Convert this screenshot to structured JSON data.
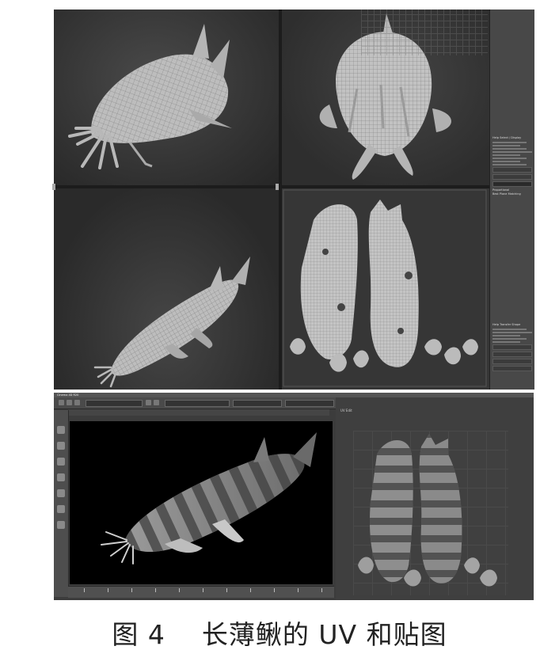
{
  "top": {
    "viewports": [
      {
        "id": "perspective-top-left"
      },
      {
        "id": "perspective-top-right"
      },
      {
        "id": "perspective-bottom-left"
      }
    ],
    "uv_editor": {
      "grid": true
    },
    "side_panel": {
      "section1_title": "Help Select / Display",
      "section2_title": "Help Transfer Shape",
      "checkbox1": "Proportional",
      "checkbox2": "Best Plane Matching"
    }
  },
  "bottom": {
    "menubar_title": "Cinema 4D R20",
    "render_background": "#000000",
    "texture_label": "UV Edit"
  },
  "caption": {
    "figure": "图 4",
    "text": "长薄鳅的 UV 和贴图"
  },
  "colors": {
    "panel_bg": "#3a3a3a",
    "mesh": "#bdbdbd",
    "wire": "#8a8a8a"
  },
  "icons": [
    "move-tool-icon",
    "rotate-tool-icon",
    "scale-tool-icon",
    "render-icon",
    "camera-icon"
  ]
}
